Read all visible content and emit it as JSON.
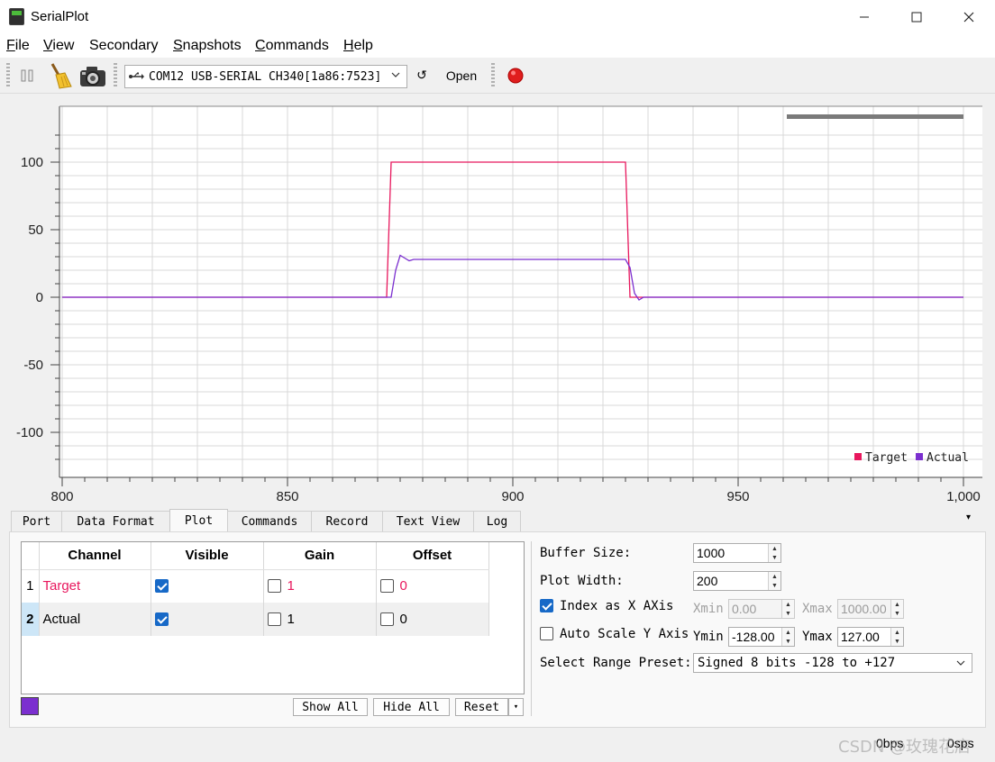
{
  "window": {
    "title": "SerialPlot"
  },
  "menu": [
    {
      "key": "F",
      "rest": "ile"
    },
    {
      "key": "V",
      "rest": "iew"
    },
    {
      "key": "",
      "rest": "Secondary"
    },
    {
      "key": "S",
      "rest": "napshots"
    },
    {
      "key": "C",
      "rest": "ommands"
    },
    {
      "key": "H",
      "rest": "elp"
    }
  ],
  "toolbar": {
    "port": "COM12 USB-SERIAL CH340[1a86:7523]",
    "refresh_glyph": "↺",
    "open_label": "Open"
  },
  "chart_data": {
    "type": "line",
    "xlim": [
      800,
      1000
    ],
    "ylim": [
      -128,
      127
    ],
    "x_ticks": [
      800,
      850,
      900,
      950,
      1000
    ],
    "x_tick_labels": [
      "800",
      "850",
      "900",
      "950",
      "1,000"
    ],
    "y_ticks": [
      -100,
      -50,
      0,
      50,
      100
    ],
    "y_tick_labels": [
      "-100",
      "-50",
      "0",
      "50",
      "100"
    ],
    "grid": true,
    "legend_position": "bottom-right",
    "series": [
      {
        "name": "Target",
        "color": "#e8175d",
        "points": [
          [
            800,
            0
          ],
          [
            872,
            0
          ],
          [
            873,
            100
          ],
          [
            925,
            100
          ],
          [
            926,
            0
          ],
          [
            1000,
            0
          ]
        ]
      },
      {
        "name": "Actual",
        "color": "#7b2fcf",
        "points": [
          [
            800,
            0
          ],
          [
            873,
            0
          ],
          [
            874,
            20
          ],
          [
            875,
            31
          ],
          [
            876,
            29
          ],
          [
            877,
            27
          ],
          [
            878,
            28
          ],
          [
            880,
            28
          ],
          [
            890,
            28
          ],
          [
            900,
            28
          ],
          [
            910,
            28
          ],
          [
            920,
            28
          ],
          [
            925,
            28
          ],
          [
            926,
            22
          ],
          [
            927,
            3
          ],
          [
            928,
            -2
          ],
          [
            929,
            0
          ],
          [
            1000,
            0
          ]
        ]
      }
    ]
  },
  "tabs": [
    "Port",
    "Data Format",
    "Plot",
    "Commands",
    "Record",
    "Text View",
    "Log"
  ],
  "active_tab": "Plot",
  "overflow_glyph": "▾",
  "channels": {
    "headers": [
      "Channel",
      "Visible",
      "Gain",
      "Offset"
    ],
    "rows": [
      {
        "index": "1",
        "name": "Target",
        "visible": true,
        "gain": "1",
        "offset": "0",
        "color": "#e8175d"
      },
      {
        "index": "2",
        "name": "Actual",
        "visible": true,
        "gain": "1",
        "offset": "0",
        "color": "#000000"
      }
    ],
    "swatch_color": "#7b2fcf",
    "buttons": {
      "show_all": "Show All",
      "hide_all": "Hide All",
      "reset": "Reset",
      "reset_menu_glyph": "▾"
    }
  },
  "plot_settings": {
    "buffer_size_label": "Buffer Size:",
    "buffer_size": "1000",
    "plot_width_label": "Plot Width:",
    "plot_width": "200",
    "index_as_x_label": "Index as X AXis",
    "index_as_x": true,
    "xmin_label": "Xmin",
    "xmin": "0.00",
    "xmax_label": "Xmax",
    "xmax": "1000.00",
    "auto_scale_label": "Auto Scale Y Axis",
    "auto_scale": false,
    "ymin_label": "Ymin",
    "ymin": "-128.00",
    "ymax_label": "Ymax",
    "ymax": "127.00",
    "range_preset_label": "Select Range Preset:",
    "range_preset": "Signed 8 bits -128 to +127"
  },
  "status": {
    "rate1": "0bps",
    "rate2": "0sps"
  },
  "watermark": "CSDN @玫瑰花店"
}
